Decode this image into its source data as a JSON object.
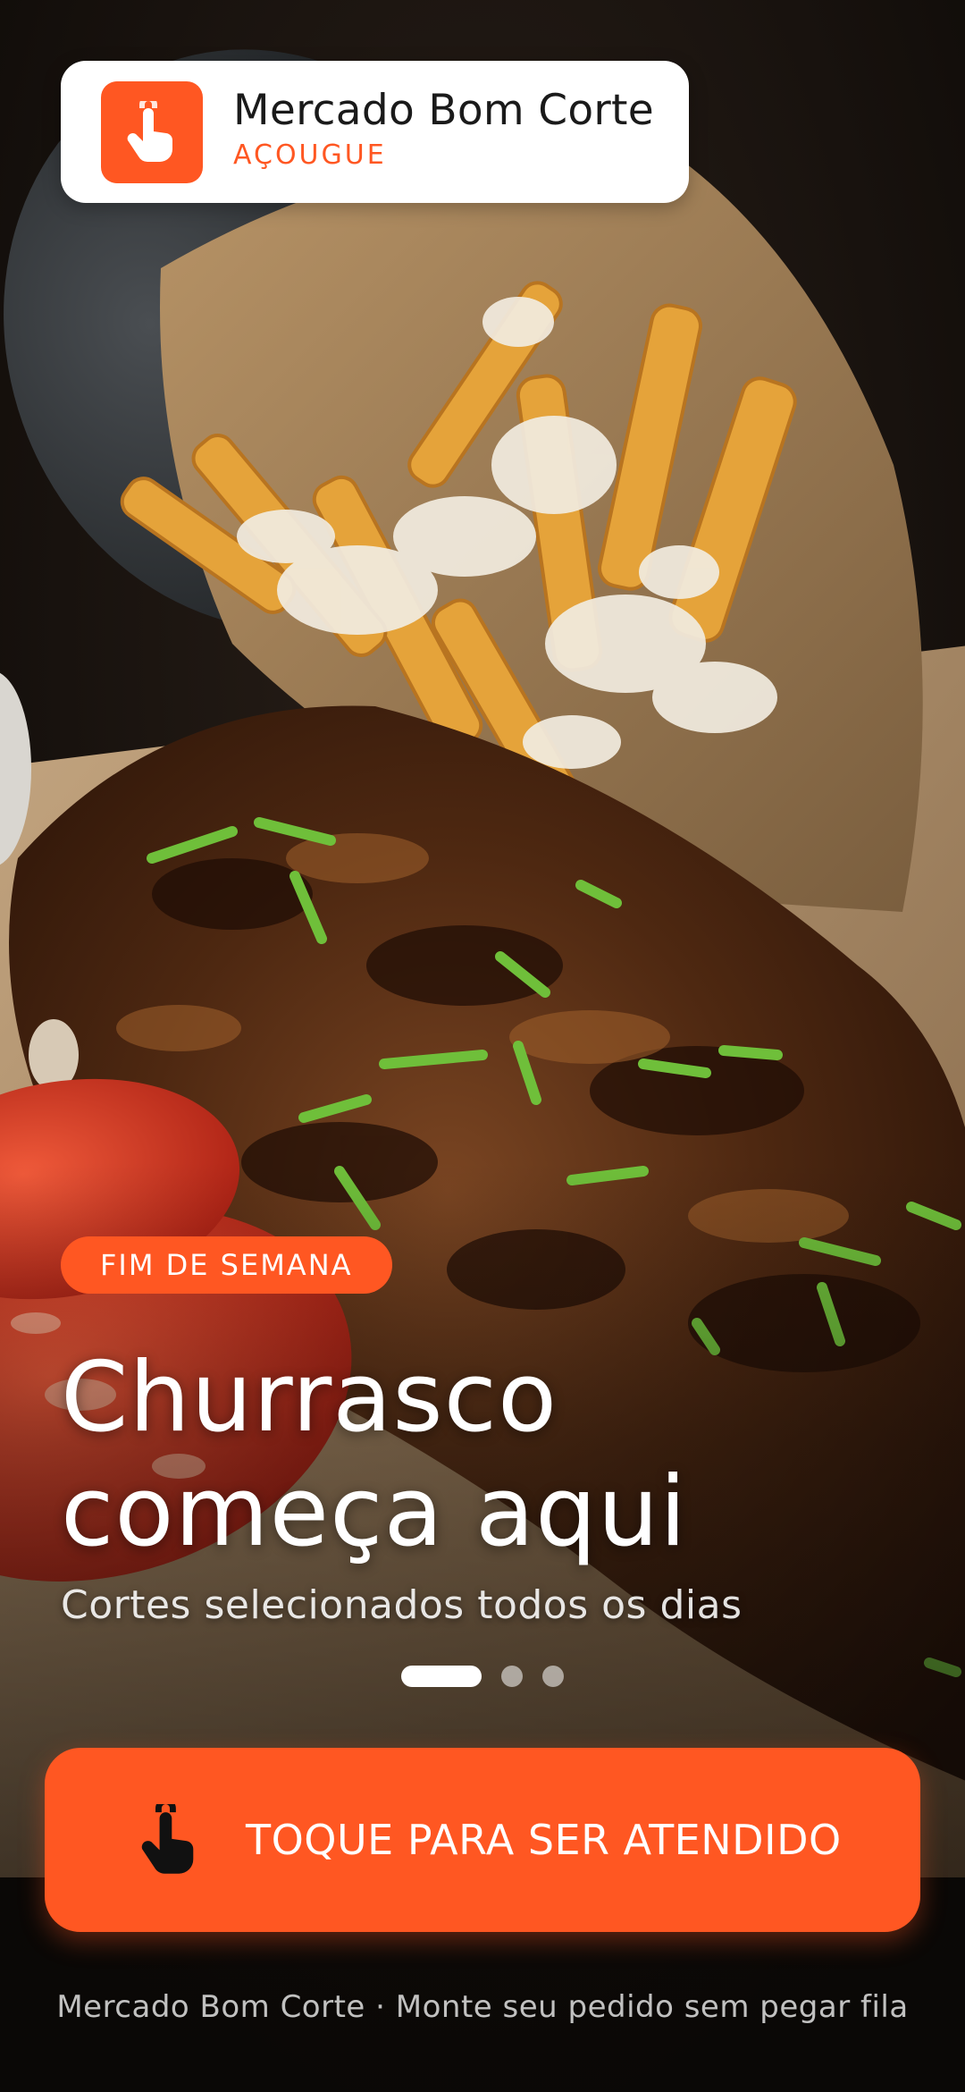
{
  "brand": {
    "name": "Mercado Bom Corte",
    "category": "AÇOUGUE",
    "logo_icon": "tap-hand-icon",
    "accent_color": "#ff5722"
  },
  "hero": {
    "image_subject": "ribs-fries-tomato-photo",
    "badge": "FIM DE SEMANA",
    "headline_line1": "Churrasco",
    "headline_line2": "começa aqui",
    "subtitle": "Cortes selecionados todos os dias"
  },
  "carousel": {
    "slides": 3,
    "active_index": 0
  },
  "cta": {
    "label": "TOQUE PARA SER ATENDIDO",
    "icon": "tap-hand-icon"
  },
  "footer": {
    "text": "Mercado Bom Corte · Monte seu pedido sem pegar fila"
  }
}
